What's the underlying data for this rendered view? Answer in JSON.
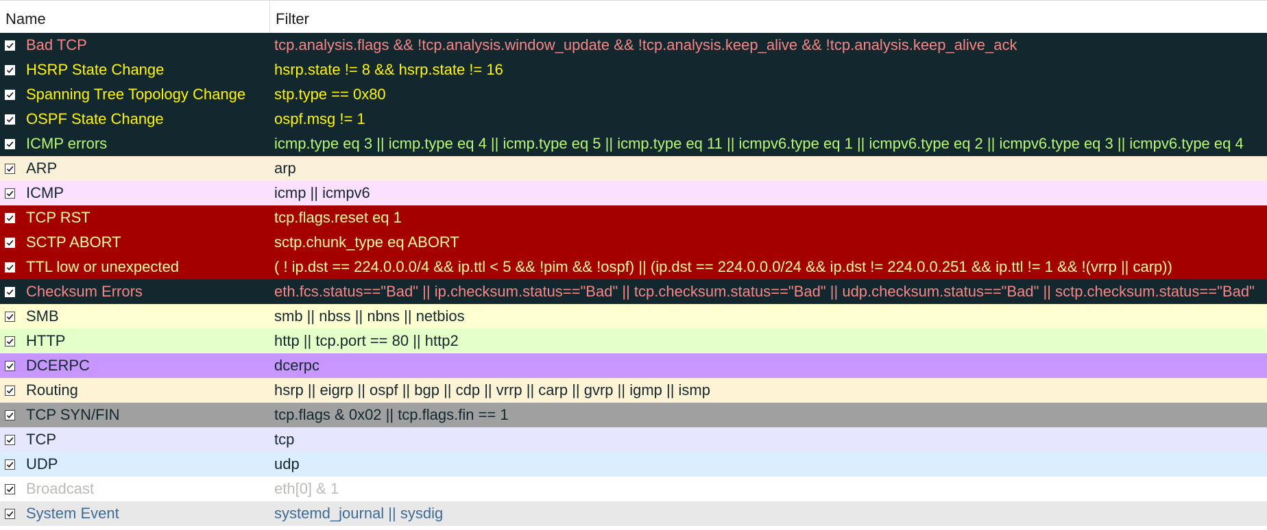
{
  "columns": {
    "name": "Name",
    "filter": "Filter"
  },
  "rows": [
    {
      "name": "Bad TCP",
      "filter": "tcp.analysis.flags && !tcp.analysis.window_update && !tcp.analysis.keep_alive && !tcp.analysis.keep_alive_ack",
      "bg": "#12272e",
      "fg": "#f78787",
      "checked": true,
      "dark": true
    },
    {
      "name": "HSRP State Change",
      "filter": "hsrp.state != 8 && hsrp.state != 16",
      "bg": "#12272e",
      "fg": "#fff600",
      "checked": true,
      "dark": true
    },
    {
      "name": "Spanning Tree Topology  Change",
      "filter": "stp.type == 0x80",
      "bg": "#12272e",
      "fg": "#fff600",
      "checked": true,
      "dark": true
    },
    {
      "name": "OSPF State Change",
      "filter": "ospf.msg != 1",
      "bg": "#12272e",
      "fg": "#fff600",
      "checked": true,
      "dark": true
    },
    {
      "name": "ICMP errors",
      "filter": "icmp.type eq 3 || icmp.type eq 4 || icmp.type eq 5 || icmp.type eq 11 || icmpv6.type eq 1 || icmpv6.type eq 2 || icmpv6.type eq 3 || icmpv6.type eq 4",
      "bg": "#12272e",
      "fg": "#b7f774",
      "checked": true,
      "dark": true
    },
    {
      "name": "ARP",
      "filter": "arp",
      "bg": "#faf0d7",
      "fg": "#12272e",
      "checked": true,
      "dark": false
    },
    {
      "name": "ICMP",
      "filter": "icmp || icmpv6",
      "bg": "#fce0ff",
      "fg": "#12272e",
      "checked": true,
      "dark": false
    },
    {
      "name": "TCP RST",
      "filter": "tcp.flags.reset eq 1",
      "bg": "#a40000",
      "fg": "#fffc9c",
      "checked": true,
      "dark": true
    },
    {
      "name": "SCTP ABORT",
      "filter": "sctp.chunk_type eq ABORT",
      "bg": "#a40000",
      "fg": "#fffc9c",
      "checked": true,
      "dark": true
    },
    {
      "name": "TTL low or unexpected",
      "filter": "( ! ip.dst == 224.0.0.0/4 && ip.ttl < 5 && !pim && !ospf) || (ip.dst == 224.0.0.0/24 && ip.dst != 224.0.0.251 && ip.ttl != 1 && !(vrrp || carp))",
      "bg": "#a40000",
      "fg": "#fffc9c",
      "checked": true,
      "dark": true
    },
    {
      "name": "Checksum Errors",
      "filter": "eth.fcs.status==\"Bad\" || ip.checksum.status==\"Bad\" || tcp.checksum.status==\"Bad\" || udp.checksum.status==\"Bad\" || sctp.checksum.status==\"Bad\"",
      "bg": "#12272e",
      "fg": "#f78787",
      "checked": true,
      "dark": true
    },
    {
      "name": "SMB",
      "filter": "smb || nbss || nbns || netbios",
      "bg": "#feffd0",
      "fg": "#12272e",
      "checked": true,
      "dark": false
    },
    {
      "name": "HTTP",
      "filter": "http || tcp.port == 80 || http2",
      "bg": "#e4ffc7",
      "fg": "#12272e",
      "checked": true,
      "dark": false
    },
    {
      "name": "DCERPC",
      "filter": "dcerpc",
      "bg": "#c797ff",
      "fg": "#12272e",
      "checked": true,
      "dark": false
    },
    {
      "name": "Routing",
      "filter": "hsrp || eigrp || ospf || bgp || cdp || vrrp || carp || gvrp || igmp || ismp",
      "bg": "#fff3d6",
      "fg": "#12272e",
      "checked": true,
      "dark": false
    },
    {
      "name": "TCP SYN/FIN",
      "filter": "tcp.flags & 0x02 || tcp.flags.fin == 1",
      "bg": "#a0a0a0",
      "fg": "#12272e",
      "checked": true,
      "dark": false
    },
    {
      "name": "TCP",
      "filter": "tcp",
      "bg": "#e7e6ff",
      "fg": "#12272e",
      "checked": true,
      "dark": false
    },
    {
      "name": "UDP",
      "filter": "udp",
      "bg": "#daeeff",
      "fg": "#12272e",
      "checked": true,
      "dark": false
    },
    {
      "name": "Broadcast",
      "filter": "eth[0] & 1",
      "bg": "#ffffff",
      "fg": "#babdb6",
      "checked": true,
      "dark": false
    },
    {
      "name": "System Event",
      "filter": "systemd_journal || sysdig",
      "bg": "#e8e8e8",
      "fg": "#3e6a96",
      "checked": true,
      "dark": false
    }
  ],
  "icons": {
    "checkbox": "check-mark"
  }
}
